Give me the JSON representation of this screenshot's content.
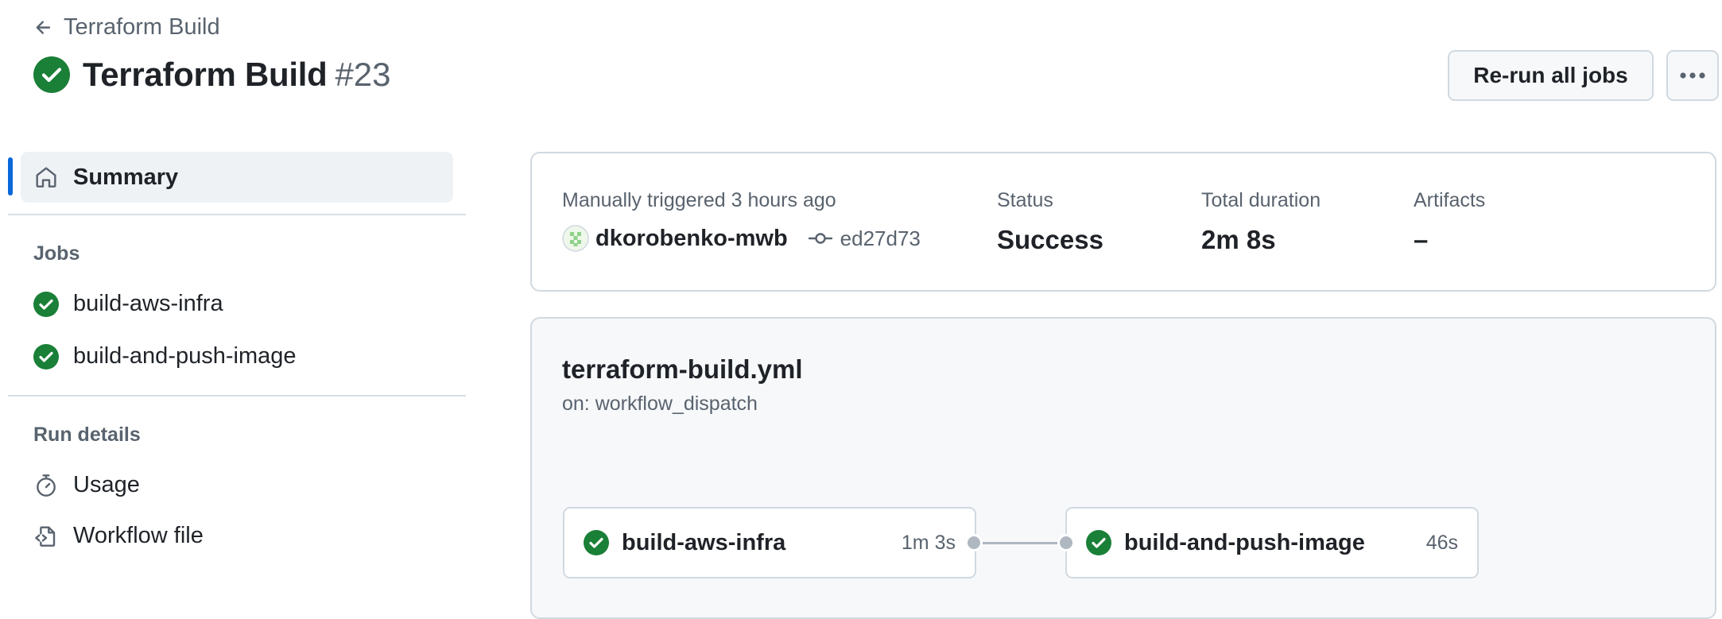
{
  "header": {
    "back_label": "Terraform Build",
    "title": "Terraform Build",
    "run_number": "#23",
    "rerun_label": "Re-run all jobs"
  },
  "sidebar": {
    "summary_label": "Summary",
    "jobs_heading": "Jobs",
    "jobs": [
      {
        "label": "build-aws-infra",
        "status": "success"
      },
      {
        "label": "build-and-push-image",
        "status": "success"
      }
    ],
    "run_details_heading": "Run details",
    "details": [
      {
        "label": "Usage",
        "icon": "stopwatch-icon"
      },
      {
        "label": "Workflow file",
        "icon": "file-code-icon"
      }
    ]
  },
  "summary": {
    "trigger_text": "Manually triggered 3 hours ago",
    "actor": "dkorobenko-mwb",
    "commit_sha": "ed27d73",
    "status_label": "Status",
    "status_value": "Success",
    "duration_label": "Total duration",
    "duration_value": "2m 8s",
    "artifacts_label": "Artifacts",
    "artifacts_value": "–"
  },
  "workflow": {
    "file_name": "terraform-build.yml",
    "trigger": "on: workflow_dispatch",
    "jobs": [
      {
        "name": "build-aws-infra",
        "duration": "1m 3s",
        "status": "success"
      },
      {
        "name": "build-and-push-image",
        "duration": "46s",
        "status": "success"
      }
    ]
  },
  "colors": {
    "success": "#1a7f37",
    "accent": "#0969da",
    "muted_text": "#59636e",
    "border": "#d1d9e0"
  }
}
